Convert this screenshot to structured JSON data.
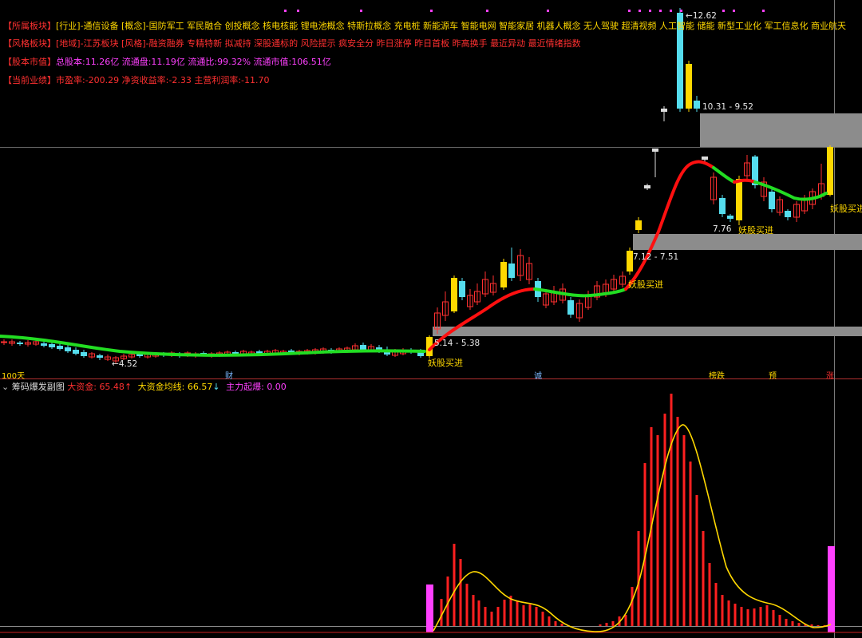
{
  "info": {
    "row1": {
      "tag": "【所属板块】",
      "text": "[行业]-通信设备 [概念]-国防军工 军民融合 创投概念 核电核能 锂电池概念 特斯拉概念 充电桩 新能源车 智能电网 智能家居 机器人概念 无人驾驶 超清视频 人工智能 储能 新型工业化 军工信息化 商业航天"
    },
    "row2": {
      "tag": "【风格板块】",
      "text": "[地域]-江苏板块 [风格]-融资融券 专精特新 拟减持 深股通标的 风险提示 疯安全分 昨日涨停 昨日首板 昨高换手 最近异动 最近情绪指数"
    },
    "row3": {
      "tag": "【股本市值】",
      "text": "总股本:11.26亿 流通盘:11.19亿 流通比:99.32% 流通市值:106.51亿"
    },
    "row4": {
      "tag": "【当前业绩】",
      "text": "市盈率:-200.29 净资收益率:-2.33 主营利润率:-11.70"
    }
  },
  "price_labels": {
    "high": "12.62",
    "zone_top": "10.31 - 9.52",
    "zone_mid": "7.12 - 7.51",
    "zone_low": "5.14 - 5.38",
    "low": "4.52",
    "recent_low": "7.76"
  },
  "signals": {
    "buy1": "妖股买进",
    "buy2": "妖股买进",
    "buy3": "妖股买进",
    "buy4": "妖股买进"
  },
  "timeline": {
    "period": "100天",
    "ev1": "财",
    "ev2": "诚",
    "ev3": "榜跌",
    "ev4": "预",
    "ev5": "涨"
  },
  "sub_panel": {
    "name": "筹码爆发副图",
    "big_fund_label": "大资金:",
    "big_fund_value": "65.48",
    "big_fund_arrow": "↑",
    "avg_label": "大资金均线:",
    "avg_value": "66.57",
    "avg_arrow": "↓",
    "main_label": "主力起爆:",
    "main_value": "0.00"
  },
  "colors": {
    "up_red": "#ff3030",
    "down_cyan": "#55ddee",
    "signal_yellow": "#ffd800",
    "ma_green": "#22dd22",
    "ma_red": "#ff1010",
    "zone_gray": "#8c8c8c",
    "magenta": "#ff40ff"
  },
  "chart_data": {
    "type": "candlestick+indicator",
    "price_axis_labels": [
      "12.62",
      "4.52"
    ],
    "price_zones": [
      {
        "from": 9.52,
        "to": 10.31
      },
      {
        "from": 7.12,
        "to": 7.51
      },
      {
        "from": 5.14,
        "to": 5.38
      }
    ],
    "sub_indicator": {
      "big_fund": 65.48,
      "big_fund_ma": 66.57,
      "main_burst": 0.0
    }
  }
}
